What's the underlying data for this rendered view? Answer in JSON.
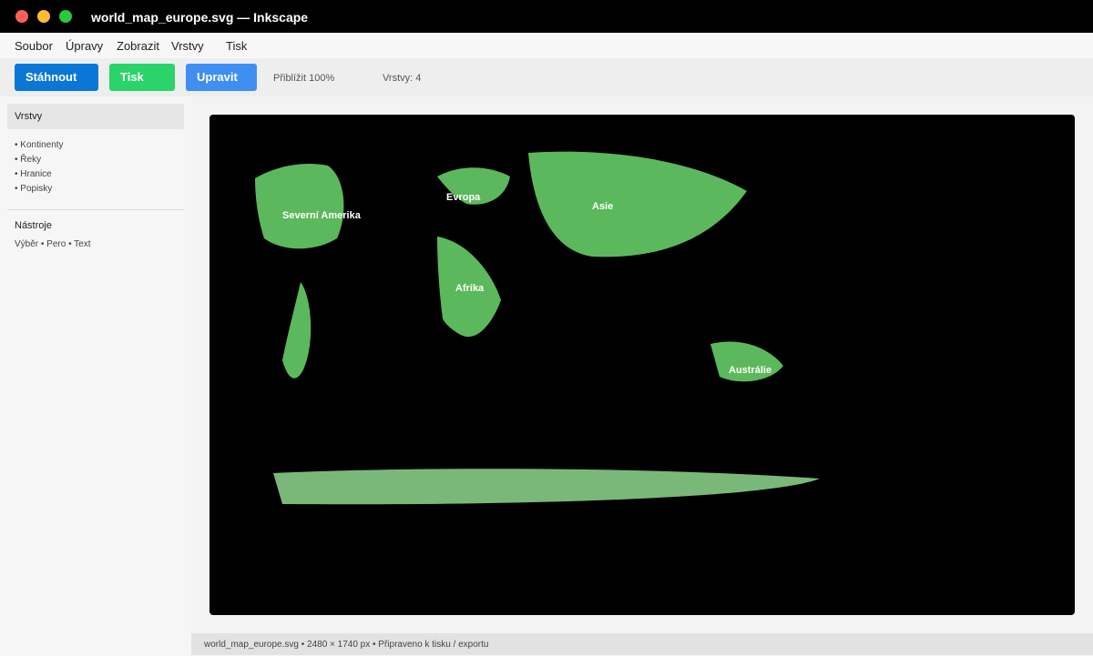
{
  "window": {
    "title": "world_map_europe.svg — Inkscape"
  },
  "menu": {
    "items": [
      "Soubor",
      "Úpravy",
      "Zobrazit",
      "Vrstvy",
      "Tisk"
    ]
  },
  "toolbar": {
    "download_label": "Stáhnout",
    "print_label": "Tisk",
    "edit_label": "Upravit",
    "zoom_text": "Přiblížit 100%",
    "layers_count_text": "Vrstvy: 4"
  },
  "sidebar": {
    "layers_title": "Vrstvy",
    "layers": [
      "• Kontinenty",
      "• Řeky",
      "• Hranice",
      "• Popisky"
    ],
    "tools_title": "Nástroje",
    "tools_text": "Výběr • Pero • Text"
  },
  "map": {
    "labels": {
      "north_america": "Severní Amerika",
      "europe": "Evropa",
      "asia": "Asie",
      "africa": "Afrika",
      "australia": "Austrálie"
    },
    "colors": {
      "background": "#000000",
      "continent": "#5cb85c",
      "antarctica": "#7ab87a"
    }
  },
  "status": {
    "text": "world_map_europe.svg • 2480 × 1740 px • Připraveno k tisku / exportu"
  },
  "colors": {
    "btn_download": "#0a77d6",
    "btn_print": "#2bd36b",
    "btn_edit": "#3f8ef2"
  }
}
